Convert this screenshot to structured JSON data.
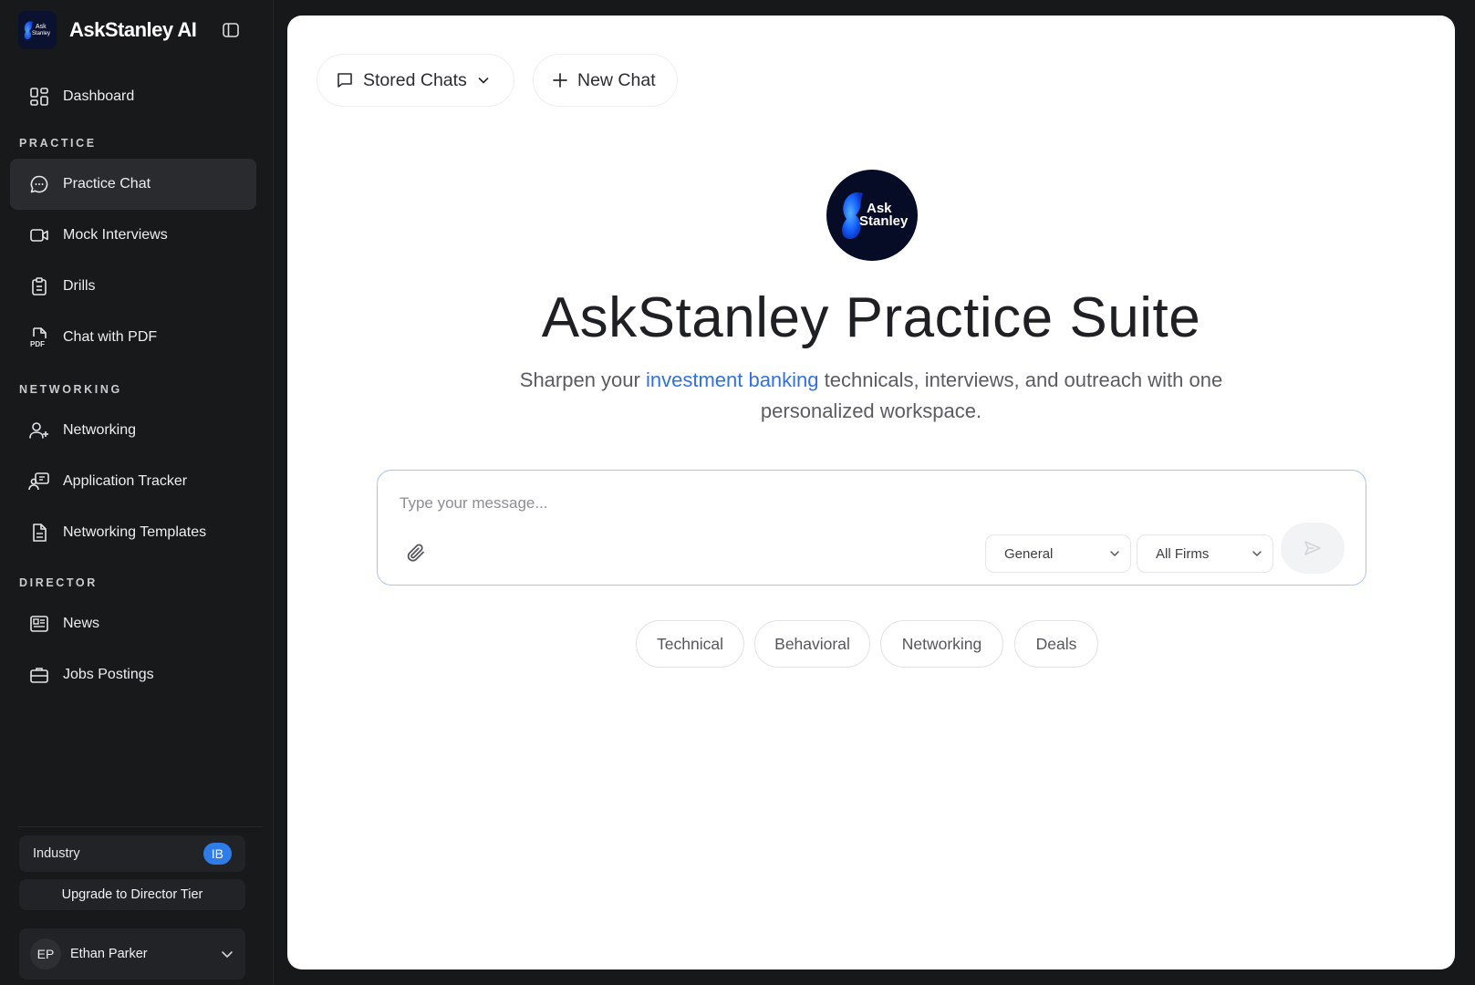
{
  "brand": {
    "name": "AskStanley AI",
    "logo_text_1": "Ask",
    "logo_text_2": "Stanley"
  },
  "sidebar": {
    "dashboard": "Dashboard",
    "sections": {
      "practice": "PRACTICE",
      "networking": "NETWORKING",
      "director": "DIRECTOR"
    },
    "items": [
      {
        "label": "Practice Chat",
        "icon": "chat-bubble-icon",
        "active": true
      },
      {
        "label": "Mock Interviews",
        "icon": "video-camera-icon"
      },
      {
        "label": "Drills",
        "icon": "clipboard-icon"
      },
      {
        "label": "Chat with PDF",
        "icon": "pdf-file-icon"
      },
      {
        "label": "Networking",
        "icon": "user-plus-icon"
      },
      {
        "label": "Application Tracker",
        "icon": "presenter-icon"
      },
      {
        "label": "Networking Templates",
        "icon": "document-icon"
      },
      {
        "label": "News",
        "icon": "newspaper-icon"
      },
      {
        "label": "Jobs Postings",
        "icon": "briefcase-icon"
      }
    ],
    "industry": {
      "label": "Industry",
      "badge": "IB"
    },
    "upgrade": "Upgrade to Director Tier",
    "user": {
      "initials": "EP",
      "name": "Ethan Parker"
    }
  },
  "main": {
    "stored_chats": "Stored Chats",
    "new_chat": "New Chat",
    "hero_logo_1": "Ask",
    "hero_logo_2": "Stanley",
    "title": "AskStanley Practice Suite",
    "subtitle_pre": "Sharpen your ",
    "subtitle_highlight": "investment banking",
    "subtitle_post": " technicals, interviews, and outreach with one personalized workspace.",
    "composer": {
      "placeholder": "Type your message...",
      "category_selected": "General",
      "firm_selected": "All Firms"
    },
    "chips": [
      "Technical",
      "Behavioral",
      "Networking",
      "Deals"
    ]
  },
  "colors": {
    "accent": "#2e73e0",
    "sidebar_bg": "#18191b",
    "active_item_bg": "#2a2b2f",
    "badge_blue": "#2f7be8"
  }
}
